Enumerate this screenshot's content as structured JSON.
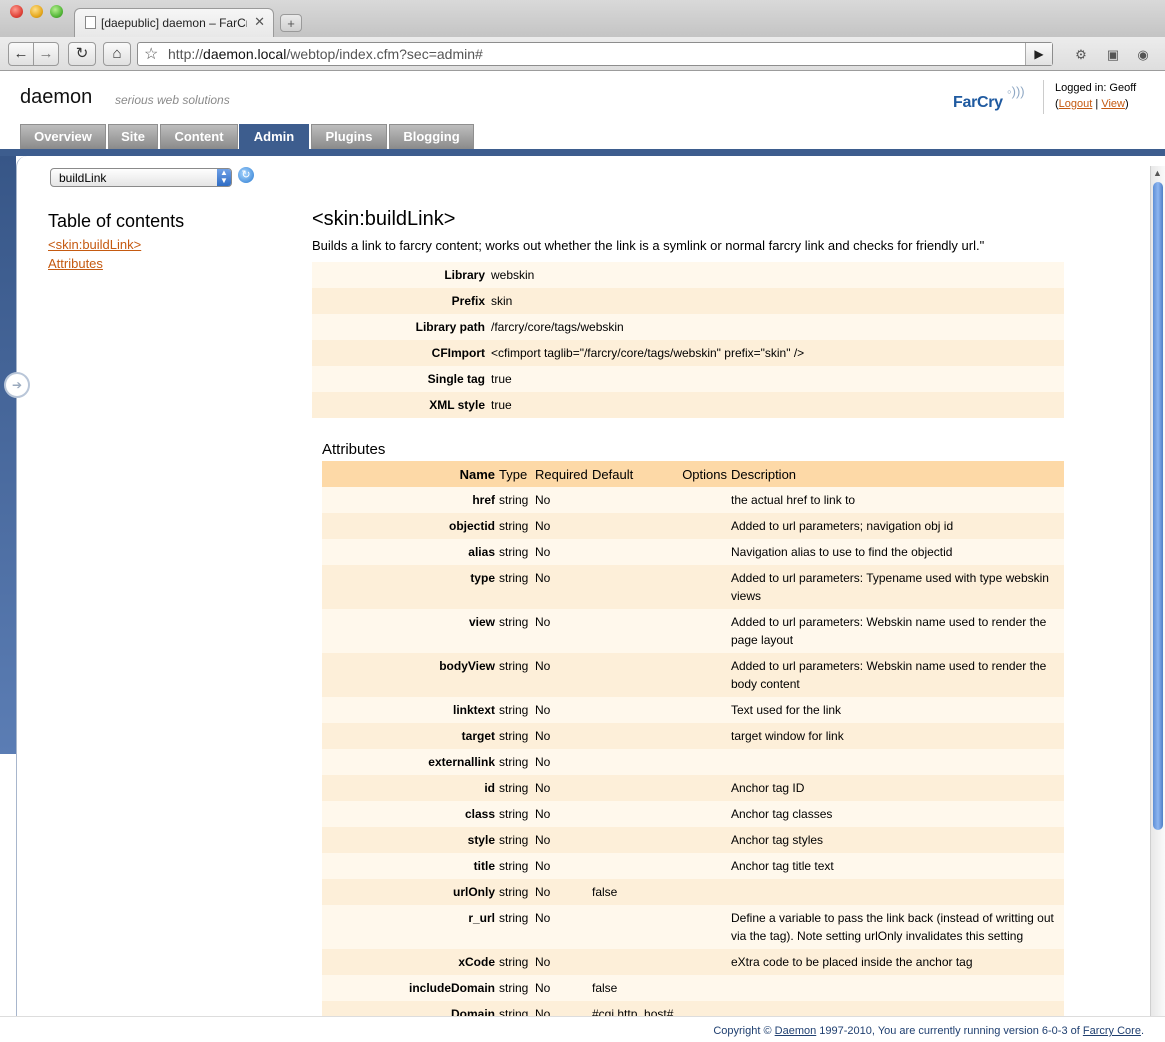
{
  "browser": {
    "tab_title": "[daepublic] daemon – FarCry",
    "url_prefix": "http://",
    "url_host": "daemon.local",
    "url_path": "/webtop/index.cfm?sec=admin#"
  },
  "header": {
    "site_name": "daemon",
    "tagline": "serious web solutions",
    "logo_text": "FarCry",
    "logged_in_label": "Logged in: Geoff",
    "logout_label": "Logout",
    "view_label": "View"
  },
  "nav": {
    "tabs": [
      {
        "label": "Overview"
      },
      {
        "label": "Site"
      },
      {
        "label": "Content"
      },
      {
        "label": "Admin"
      },
      {
        "label": "Plugins"
      },
      {
        "label": "Blogging"
      }
    ],
    "active": "Admin"
  },
  "sidebar": {
    "select_value": "buildLink",
    "toc_title": "Table of contents",
    "toc_links": [
      "<skin:buildLink>",
      "Attributes"
    ]
  },
  "doc": {
    "title": "<skin:buildLink>",
    "description": "Builds a link to farcry content; works out whether the link is a symlink or normal farcry link and checks for friendly url.\"",
    "properties": [
      {
        "key": "Library",
        "value": "webskin"
      },
      {
        "key": "Prefix",
        "value": "skin"
      },
      {
        "key": "Library path",
        "value": "/farcry/core/tags/webskin"
      },
      {
        "key": "CFImport",
        "value": "<cfimport taglib=\"/farcry/core/tags/webskin\" prefix=\"skin\" />"
      },
      {
        "key": "Single tag",
        "value": "true"
      },
      {
        "key": "XML style",
        "value": "true"
      }
    ],
    "attributes_title": "Attributes",
    "attr_headers": [
      "Name",
      "Type",
      "Required",
      "Default",
      "Options",
      "Description"
    ],
    "attributes": [
      {
        "name": "href",
        "type": "string",
        "required": "No",
        "default": "",
        "options": "",
        "description": "the actual href to link to"
      },
      {
        "name": "objectid",
        "type": "string",
        "required": "No",
        "default": "",
        "options": "",
        "description": "Added to url parameters; navigation obj id"
      },
      {
        "name": "alias",
        "type": "string",
        "required": "No",
        "default": "",
        "options": "",
        "description": "Navigation alias to use to find the objectid"
      },
      {
        "name": "type",
        "type": "string",
        "required": "No",
        "default": "",
        "options": "",
        "description": "Added to url parameters: Typename used with type webskin views"
      },
      {
        "name": "view",
        "type": "string",
        "required": "No",
        "default": "",
        "options": "",
        "description": "Added to url parameters: Webskin name used to render the page layout"
      },
      {
        "name": "bodyView",
        "type": "string",
        "required": "No",
        "default": "",
        "options": "",
        "description": "Added to url parameters: Webskin name used to render the body content"
      },
      {
        "name": "linktext",
        "type": "string",
        "required": "No",
        "default": "",
        "options": "",
        "description": "Text used for the link"
      },
      {
        "name": "target",
        "type": "string",
        "required": "No",
        "default": "",
        "options": "",
        "description": "target window for link"
      },
      {
        "name": "externallink",
        "type": "string",
        "required": "No",
        "default": "",
        "options": "",
        "description": ""
      },
      {
        "name": "id",
        "type": "string",
        "required": "No",
        "default": "",
        "options": "",
        "description": "Anchor tag ID"
      },
      {
        "name": "class",
        "type": "string",
        "required": "No",
        "default": "",
        "options": "",
        "description": "Anchor tag classes"
      },
      {
        "name": "style",
        "type": "string",
        "required": "No",
        "default": "",
        "options": "",
        "description": "Anchor tag styles"
      },
      {
        "name": "title",
        "type": "string",
        "required": "No",
        "default": "",
        "options": "",
        "description": "Anchor tag title text"
      },
      {
        "name": "urlOnly",
        "type": "string",
        "required": "No",
        "default": "false",
        "options": "",
        "description": ""
      },
      {
        "name": "r_url",
        "type": "string",
        "required": "No",
        "default": "",
        "options": "",
        "description": "Define a variable to pass the link back (instead of writting out via the tag). Note setting urlOnly invalidates this setting"
      },
      {
        "name": "xCode",
        "type": "string",
        "required": "No",
        "default": "",
        "options": "",
        "description": "eXtra code to be placed inside the anchor tag"
      },
      {
        "name": "includeDomain",
        "type": "string",
        "required": "No",
        "default": "false",
        "options": "",
        "description": ""
      },
      {
        "name": "Domain",
        "type": "string",
        "required": "No",
        "default": "#cgi.http_host#",
        "options": "",
        "description": ""
      }
    ]
  },
  "footer": {
    "copyright_prefix": "Copyright ©",
    "company_link": "Daemon",
    "copyright_middle": "1997-2010, You are currently running version 6-0-3 of",
    "product_link": "Farcry Core",
    "copyright_suffix": "."
  },
  "colors": {
    "brand_blue": "#3d5d8e",
    "link_orange": "#c55a11",
    "header_row": "#fdd9a7",
    "row_light": "#fff8ec",
    "row_dark": "#fdefd9"
  }
}
